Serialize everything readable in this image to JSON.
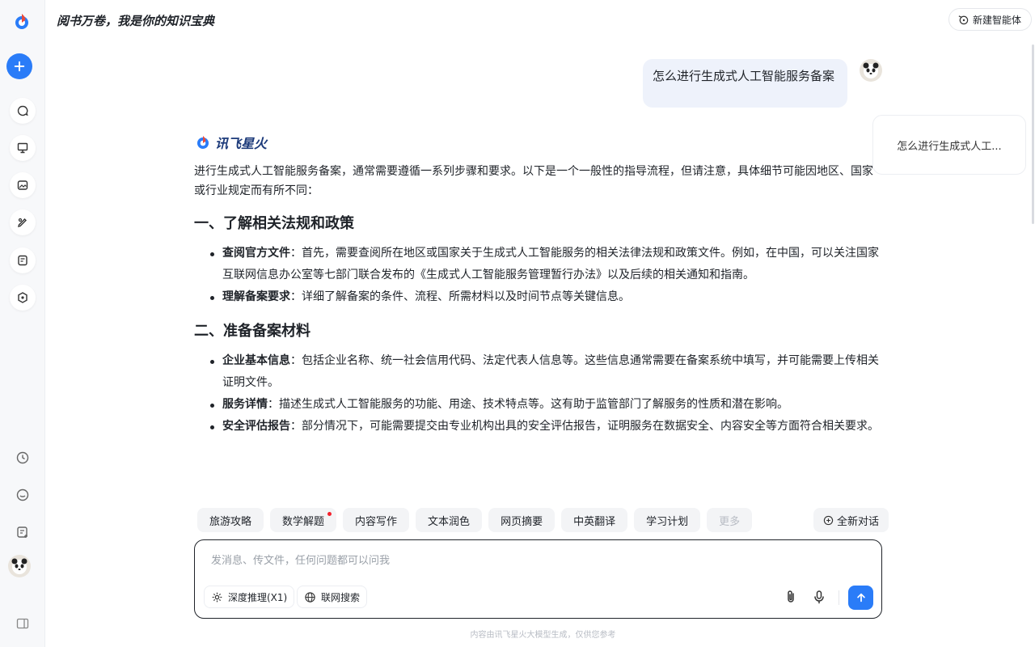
{
  "header": {
    "title": "阅书万卷，我是你的知识宝典",
    "new_agent_label": "新建智能体"
  },
  "user_message": "怎么进行生成式人工智能服务备案",
  "outline": {
    "item": "怎么进行生成式人工..."
  },
  "answer": {
    "brand": "讯飞星火",
    "intro": "进行生成式人工智能服务备案，通常需要遵循一系列步骤和要求。以下是一个一般性的指导流程，但请注意，具体细节可能因地区、国家或行业规定而有所不同：",
    "sections": [
      {
        "heading": "一、了解相关法规和政策",
        "items": [
          {
            "term": "查阅官方文件",
            "sep": "：",
            "text": "首先，需要查阅所在地区或国家关于生成式人工智能服务的相关法律法规和政策文件。例如，在中国，可以关注国家互联网信息办公室等七部门联合发布的《生成式人工智能服务管理暂行办法》以及后续的相关通知和指南。"
          },
          {
            "term": "理解备案要求",
            "sep": "：",
            "text": "详细了解备案的条件、流程、所需材料以及时间节点等关键信息。"
          }
        ]
      },
      {
        "heading": "二、准备备案材料",
        "items": [
          {
            "term": "企业基本信息",
            "sep": "：",
            "text": "包括企业名称、统一社会信用代码、法定代表人信息等。这些信息通常需要在备案系统中填写，并可能需要上传相关证明文件。"
          },
          {
            "term": "服务详情",
            "sep": "：",
            "text": "描述生成式人工智能服务的功能、用途、技术特点等。这有助于监管部门了解服务的性质和潜在影响。"
          },
          {
            "term": "安全评估报告",
            "sep": "：",
            "text": "部分情况下，可能需要提交由专业机构出具的安全评估报告，证明服务在数据安全、内容安全等方面符合相关要求。"
          }
        ]
      }
    ]
  },
  "chips": [
    "旅游攻略",
    "数学解题",
    "内容写作",
    "文本润色",
    "网页摘要",
    "中英翻译",
    "学习计划",
    "更多"
  ],
  "new_conversation_label": "全新对话",
  "input": {
    "placeholder": "发消息、传文件，任何问题都可以问我",
    "deep_reasoning_label": "深度推理(X1)",
    "web_search_label": "联网搜索"
  },
  "footer_note": "内容由讯飞星火大模型生成，仅供您参考",
  "colors": {
    "accent": "#2a7cf8",
    "brand_text": "#1c3a7a"
  }
}
